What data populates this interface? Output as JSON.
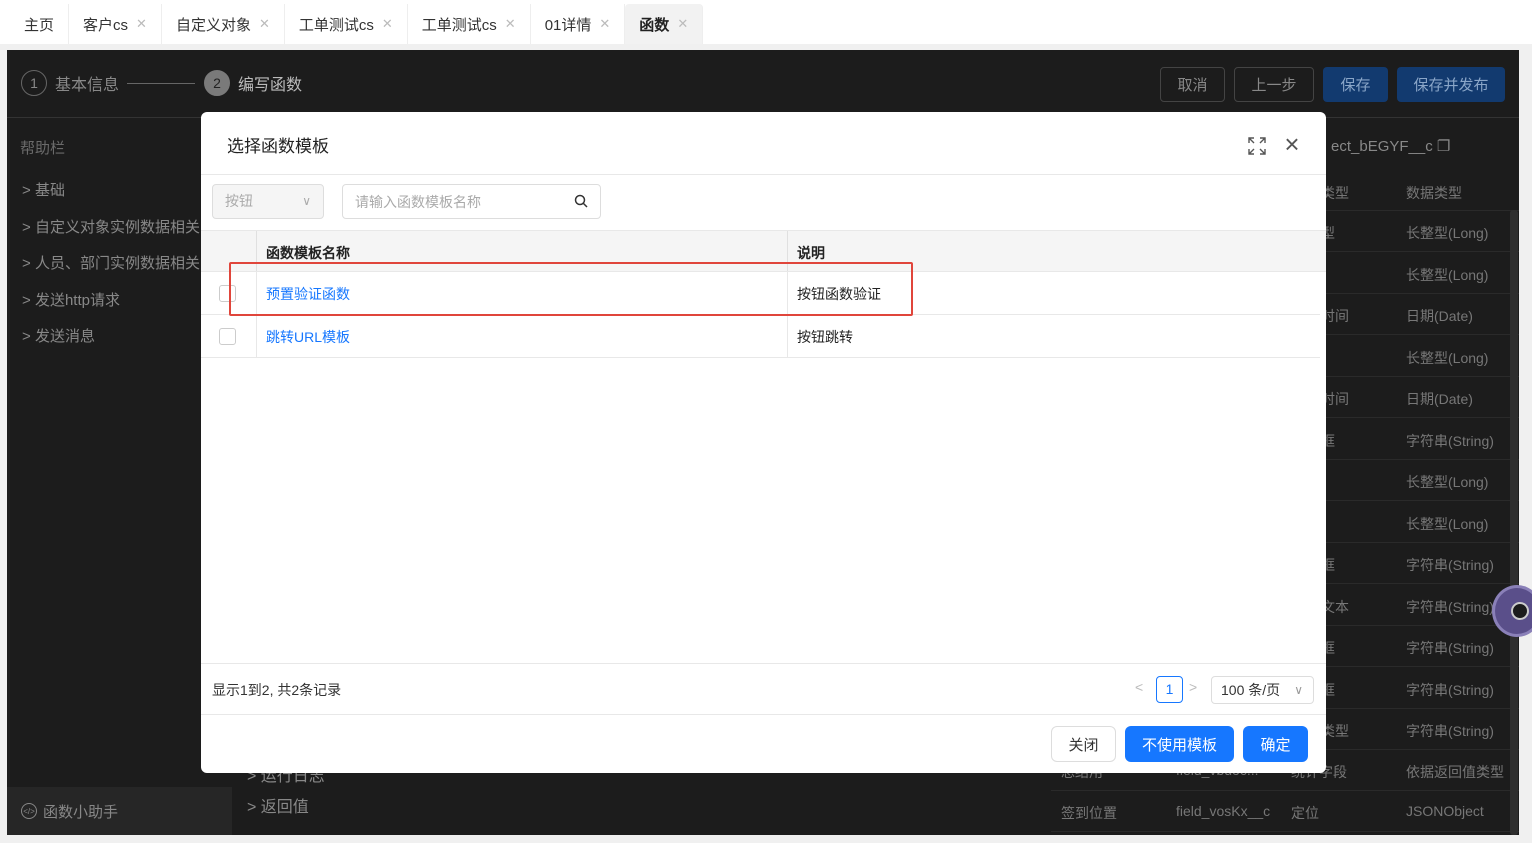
{
  "tabs": [
    {
      "label": "主页",
      "closable": false
    },
    {
      "label": "客户cs",
      "closable": true
    },
    {
      "label": "自定义对象",
      "closable": true
    },
    {
      "label": "工单测试cs",
      "closable": true
    },
    {
      "label": "工单测试cs",
      "closable": true
    },
    {
      "label": "01详情",
      "closable": true
    },
    {
      "label": "函数",
      "closable": true,
      "active": true
    }
  ],
  "steps": [
    {
      "num": "1",
      "label": "基本信息"
    },
    {
      "num": "2",
      "label": "编写函数"
    }
  ],
  "header_buttons": {
    "cancel": "取消",
    "prev": "上一步",
    "save": "保存",
    "save_publish": "保存并发布"
  },
  "sidebar": {
    "title": "帮助栏",
    "items": [
      "基础",
      "自定义对象实例数据相关",
      "人员、部门实例数据相关",
      "发送http请求",
      "发送消息"
    ],
    "footer": "函数小助手"
  },
  "middle": {
    "items": [
      "运行日志",
      "返回值"
    ]
  },
  "right_panel": {
    "api_name": "ect_bEGYF__c",
    "col_type": "类型",
    "col_data_type": "数据类型",
    "rows": [
      {
        "type": "型",
        "data_type": "长整型(Long)"
      },
      {
        "type": "",
        "data_type": "长整型(Long)"
      },
      {
        "type": "时间",
        "data_type": "日期(Date)"
      },
      {
        "type": "",
        "data_type": "长整型(Long)"
      },
      {
        "type": "时间",
        "data_type": "日期(Date)"
      },
      {
        "type": "框",
        "data_type": "字符串(String)"
      },
      {
        "type": "",
        "data_type": "长整型(Long)"
      },
      {
        "type": "",
        "data_type": "长整型(Long)"
      },
      {
        "type": "框",
        "data_type": "字符串(String)"
      },
      {
        "type": "文本",
        "data_type": "字符串(String)"
      },
      {
        "type": "框",
        "data_type": "字符串(String)"
      },
      {
        "type": "框",
        "data_type": "字符串(String)"
      },
      {
        "type": "类型",
        "data_type": "字符串(String)"
      }
    ],
    "bottom_rows": [
      {
        "name": "总结用",
        "api": "field_vbdoc...",
        "type": "统计字段",
        "data_type": "依据返回值类型"
      },
      {
        "name": "签到位置",
        "api": "field_vosKx__c",
        "type": "定位",
        "data_type": "JSONObject"
      }
    ]
  },
  "modal": {
    "title": "选择函数模板",
    "filter_select": "按钮",
    "search_placeholder": "请输入函数模板名称",
    "columns": {
      "name": "函数模板名称",
      "desc": "说明"
    },
    "rows": [
      {
        "name": "预置验证函数",
        "desc": "按钮函数验证"
      },
      {
        "name": "跳转URL模板",
        "desc": "按钮跳转"
      }
    ],
    "records_text": "显示1到2, 共2条记录",
    "current_page": "1",
    "page_size": "100 条/页",
    "buttons": {
      "close": "关闭",
      "no_template": "不使用模板",
      "confirm": "确定"
    }
  },
  "colors": {
    "primary": "#1677ff",
    "highlight_border": "#e0453b",
    "overlay_bg": "#1c1c1c"
  }
}
